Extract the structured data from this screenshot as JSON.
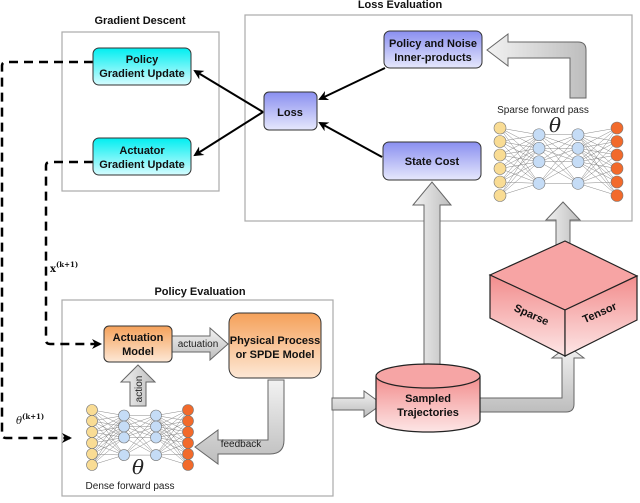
{
  "groups": {
    "gradient_descent": "Gradient Descent",
    "loss_evaluation": "Loss Evaluation",
    "policy_evaluation": "Policy Evaluation"
  },
  "nodes": {
    "policy_gradient_update": [
      "Policy",
      "Gradient Update"
    ],
    "actuator_gradient_update": [
      "Actuator",
      "Gradient Update"
    ],
    "loss": "Loss",
    "policy_noise_inner": [
      "Policy and Noise",
      "Inner-products"
    ],
    "state_cost": "State Cost",
    "actuation_model": [
      "Actuation",
      "Model"
    ],
    "physical_process": [
      "Physical Process",
      "or SPDE Model"
    ],
    "sampled_trajectories": [
      "Sampled",
      "Trajectories"
    ],
    "sparse_tensor": [
      "Sparse",
      "Tensor"
    ]
  },
  "labels": {
    "sparse_forward_pass": "Sparse forward pass",
    "dense_forward_pass": "Dense forward pass",
    "theta": "θ",
    "x_update": "x",
    "theta_update": "θ",
    "superscript": "(k+1)",
    "actuation_arrow": "actuation",
    "action_arrow": "action",
    "feedback_arrow": "feedback"
  },
  "colors": {
    "cyan": "#22eef2",
    "blue": "#8f95f0",
    "orange": "#f6a35c",
    "pink": "#f49a9a",
    "nn_input": "#f9dc94",
    "nn_hidden": "#c5dcf6",
    "nn_output": "#f26a2b"
  }
}
